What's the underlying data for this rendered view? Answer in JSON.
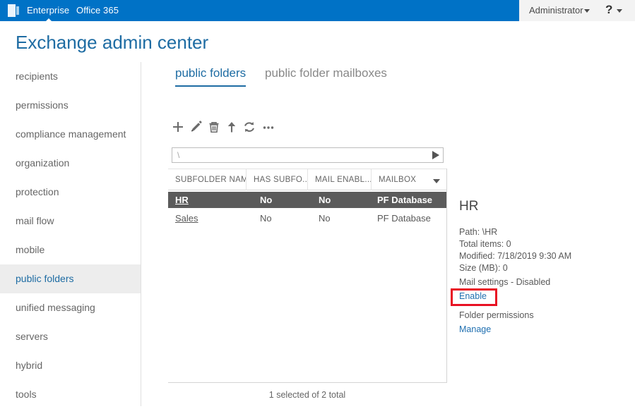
{
  "suite_bar": {
    "waffle_icon": "app-launcher-icon",
    "enterprise_label": "Enterprise",
    "office365_label": "Office 365",
    "administrator_label": "Administrator",
    "help_glyph": "?",
    "blue": "#0072c6"
  },
  "page": {
    "title": "Exchange admin center",
    "title_color": "#1e6ca3"
  },
  "sidebar": {
    "items": [
      {
        "label": "recipients",
        "selected": false
      },
      {
        "label": "permissions",
        "selected": false
      },
      {
        "label": "compliance management",
        "selected": false
      },
      {
        "label": "organization",
        "selected": false
      },
      {
        "label": "protection",
        "selected": false
      },
      {
        "label": "mail flow",
        "selected": false
      },
      {
        "label": "mobile",
        "selected": false
      },
      {
        "label": "public folders",
        "selected": true
      },
      {
        "label": "unified messaging",
        "selected": false
      },
      {
        "label": "servers",
        "selected": false
      },
      {
        "label": "hybrid",
        "selected": false
      },
      {
        "label": "tools",
        "selected": false
      }
    ]
  },
  "tabs": [
    {
      "label": "public folders",
      "active": true
    },
    {
      "label": "public folder mailboxes",
      "active": false
    }
  ],
  "toolbar": {
    "buttons": [
      {
        "name": "add-icon",
        "title": "New"
      },
      {
        "name": "edit-pencil-icon",
        "title": "Edit"
      },
      {
        "name": "delete-trash-icon",
        "title": "Delete"
      },
      {
        "name": "move-up-arrow-icon",
        "title": "Move"
      },
      {
        "name": "refresh-icon",
        "title": "Refresh"
      },
      {
        "name": "more-ellipsis-icon",
        "title": "More options"
      }
    ]
  },
  "path_bar": {
    "value": "\\",
    "go_icon": "play-triangle-icon"
  },
  "table": {
    "columns": [
      "SUBFOLDER NAME",
      "HAS SUBFO...",
      "MAIL ENABL...",
      "MAILBOX"
    ],
    "sort_icon": "chevron-down-icon",
    "rows": [
      {
        "name": "HR",
        "has_subfolders": "No",
        "mail_enabled": "No",
        "mailbox": "PF Database",
        "selected": true
      },
      {
        "name": "Sales",
        "has_subfolders": "No",
        "mail_enabled": "No",
        "mailbox": "PF Database",
        "selected": false
      }
    ]
  },
  "details": {
    "title": "HR",
    "path": "Path: \\HR",
    "total_items": "Total items: 0",
    "modified": "Modified: 7/18/2019 9:30 AM",
    "size": "Size (MB): 0",
    "mail_settings": "Mail settings - Disabled",
    "enable_link": "Enable",
    "folder_permissions": "Folder permissions",
    "manage_link": "Manage",
    "highlight_color": "#e81123",
    "link_color": "#1f6fb0"
  },
  "status": {
    "text": "1 selected of 2 total"
  }
}
